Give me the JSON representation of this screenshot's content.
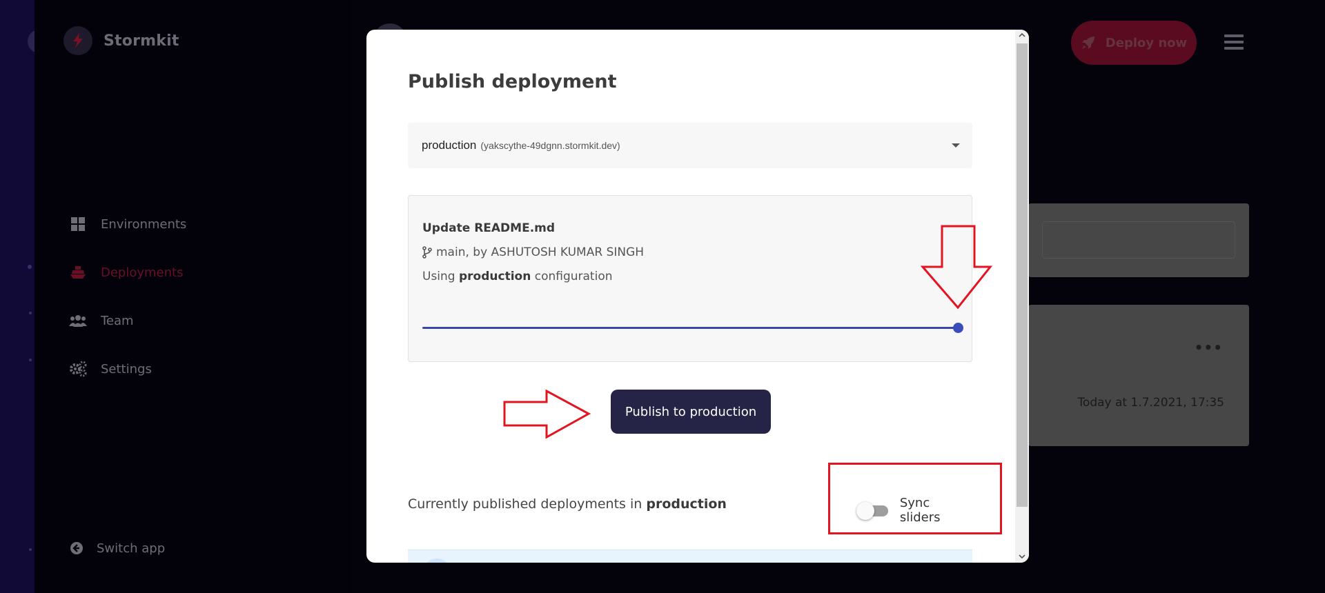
{
  "app": {
    "brand_name": "Stormkit"
  },
  "sidebar": {
    "items": [
      {
        "label": "Environments",
        "icon": "grid-icon",
        "active": false
      },
      {
        "label": "Deployments",
        "icon": "ship-icon",
        "active": true
      },
      {
        "label": "Team",
        "icon": "users-icon",
        "active": false
      },
      {
        "label": "Settings",
        "icon": "gears-icon",
        "active": false
      }
    ],
    "switch_app_label": "Switch app"
  },
  "header": {
    "deploy_label": "Deploy now"
  },
  "background": {
    "deployment_time": "Today at 1.7.2021, 17:35",
    "more_menu": "•••"
  },
  "modal": {
    "title": "Publish deployment",
    "environment": {
      "name": "production",
      "host": "(yakscythe-49dgnn.stormkit.dev)"
    },
    "commit": {
      "title": "Update README.md",
      "branch_info": "main, by ASHUTOSH KUMAR SINGH",
      "config_prefix": "Using",
      "config_env": "production",
      "config_suffix": "configuration",
      "slider_percent": 100
    },
    "publish_button": "Publish to production",
    "published_prefix": "Currently published deployments in",
    "published_env": "production",
    "sync_sliders_label": "Sync sliders",
    "sync_sliders_on": false
  },
  "colors": {
    "accent": "#3a4dbb",
    "annotation": "#e3141f",
    "publish_button": "#262446"
  }
}
